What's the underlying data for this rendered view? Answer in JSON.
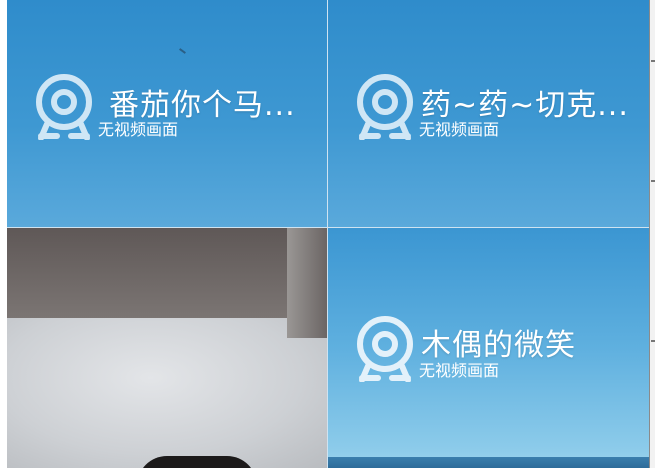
{
  "tiles": [
    {
      "name": "番茄你个马...",
      "status": "无视频画面",
      "has_video": false
    },
    {
      "name": "药~药~切克...",
      "status": "无视频画面",
      "has_video": false
    },
    {
      "name": "",
      "status": "",
      "has_video": true
    },
    {
      "name": "木偶的微笑",
      "status": "无视频画面",
      "has_video": false
    }
  ],
  "icons": {
    "camera": "webcam-icon"
  },
  "colors": {
    "sky": "#3e98d2",
    "text": "#ffffff"
  }
}
